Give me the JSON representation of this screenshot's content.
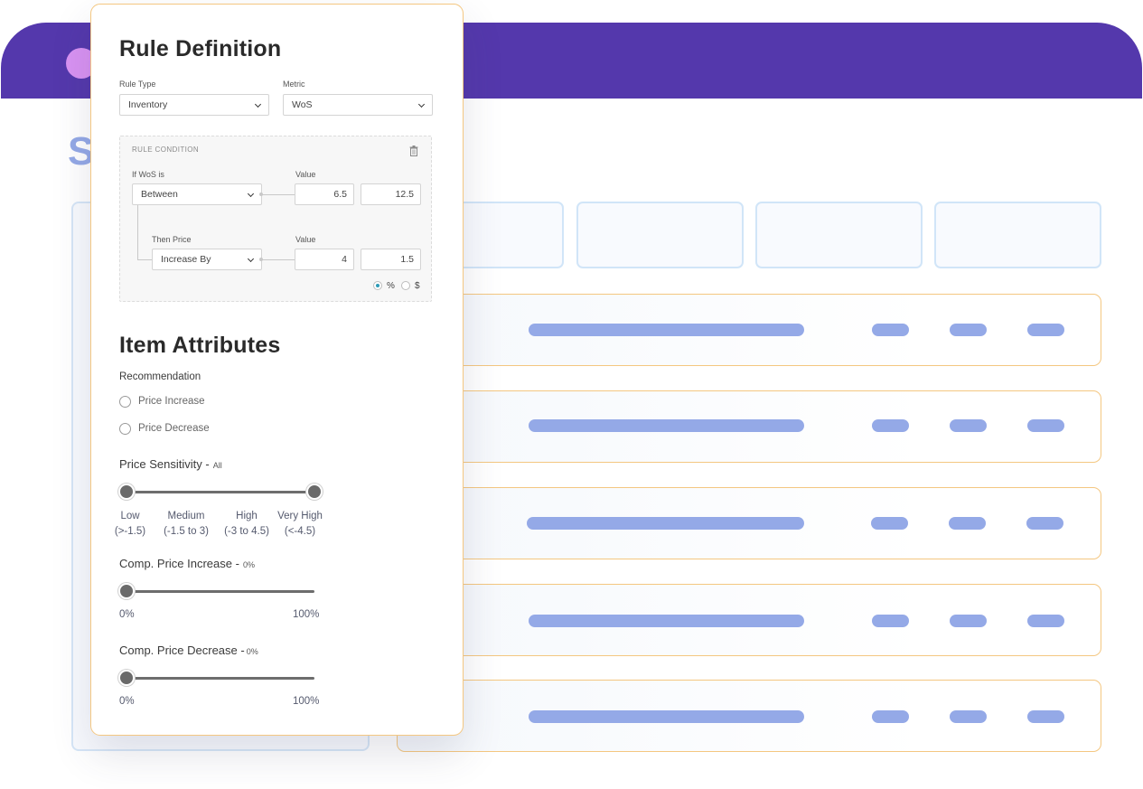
{
  "background": {
    "heading_fragment": "S",
    "brand_color": "#5438AC",
    "bar_color": "#94A9E7",
    "row_border_color": "#F4C781",
    "kpi_count": 4,
    "row_count": 5
  },
  "rule_definition": {
    "title": "Rule Definition",
    "rule_type": {
      "label": "Rule Type",
      "value": "Inventory"
    },
    "metric": {
      "label": "Metric",
      "value": "WoS"
    },
    "condition": {
      "header": "RULE CONDITION",
      "delete_icon": "trash-icon",
      "if_label": "If WoS is",
      "if_value": "Between",
      "value_label": "Value",
      "if_min": "6.5",
      "if_max": "12.5",
      "then_label": "Then Price",
      "then_value": "Increase By",
      "then_value_label": "Value",
      "then_min": "4",
      "then_max": "1.5",
      "unit_options": [
        {
          "label": "%",
          "selected": true
        },
        {
          "label": "$",
          "selected": false
        }
      ],
      "accent_color": "#2E9CB8"
    }
  },
  "item_attributes": {
    "title": "Item Attributes",
    "recommendation": {
      "label": "Recommendation",
      "options": [
        "Price Increase",
        "Price Decrease"
      ]
    },
    "price_sensitivity": {
      "label": "Price Sensitivity -",
      "selected_text": "All",
      "range_fraction": [
        0,
        1
      ],
      "scale": [
        {
          "name": "Low",
          "range": "(>-1.5)"
        },
        {
          "name": "Medium",
          "range": "(-1.5 to 3)"
        },
        {
          "name": "High",
          "range": "(-3 to 4.5)"
        },
        {
          "name": "Very High",
          "range": "(<-4.5)"
        }
      ]
    },
    "comp_price_increase": {
      "label": "Comp. Price Increase -",
      "value_text": "0%",
      "value_fraction": 0,
      "min_label": "0%",
      "max_label": "100%"
    },
    "comp_price_decrease": {
      "label": "Comp. Price Decrease -",
      "value_text": "0%",
      "value_fraction": 0,
      "min_label": "0%",
      "max_label": "100%"
    }
  }
}
